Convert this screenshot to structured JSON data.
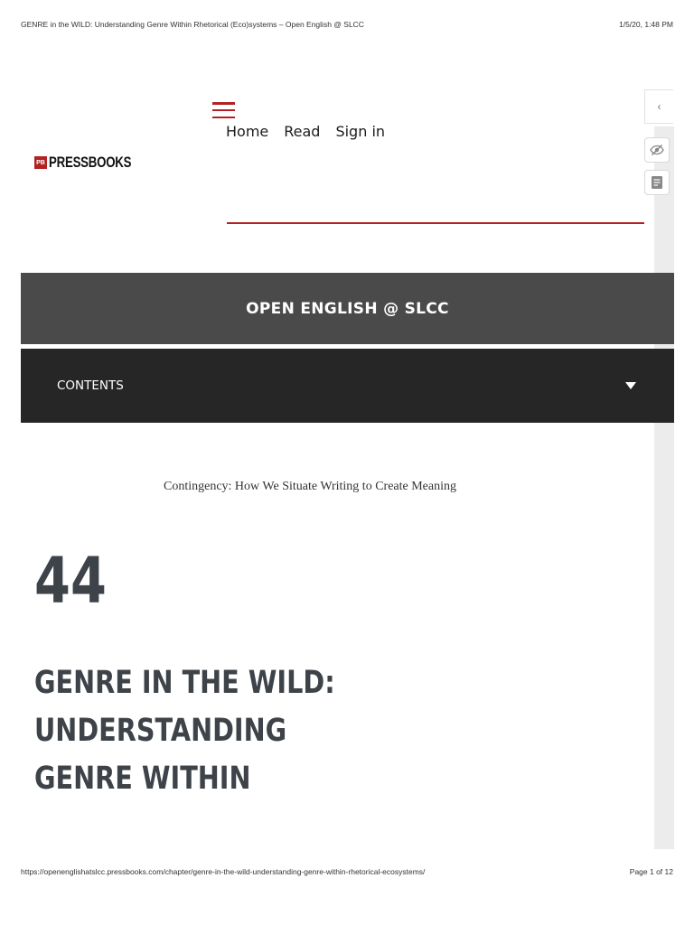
{
  "print_header": {
    "title": "GENRE in the WILD: Understanding Genre Within Rhetorical (Eco)systems – Open English @ SLCC",
    "datetime": "1/5/20, 1:48 PM"
  },
  "print_footer": {
    "url": "https://openenglishatslcc.pressbooks.com/chapter/genre-in-the-wild-understanding-genre-within-rhetorical-ecosystems/",
    "page": "Page 1 of 12"
  },
  "logo": {
    "badge": "PB",
    "text": "PRESSBOOKS"
  },
  "nav": {
    "items": [
      {
        "label": "Home"
      },
      {
        "label": "Read"
      },
      {
        "label": "Sign in"
      }
    ]
  },
  "sidebar_tools": {
    "collapse_glyph": "‹",
    "icons": [
      "hide-annotations-icon",
      "notes-icon"
    ]
  },
  "book": {
    "title": "OPEN ENGLISH @ SLCC"
  },
  "contents": {
    "label": "CONTENTS"
  },
  "chapter": {
    "part_title": "Contingency: How We Situate Writing to Create Meaning",
    "number": "44",
    "title_lines": [
      "GENRE IN THE WILD:",
      "UNDERSTANDING",
      "GENRE WITHIN"
    ]
  },
  "colors": {
    "accent": "#b22222",
    "book_band": "#4a4a4a",
    "contents_band": "#262626",
    "heading": "#3d4349"
  }
}
